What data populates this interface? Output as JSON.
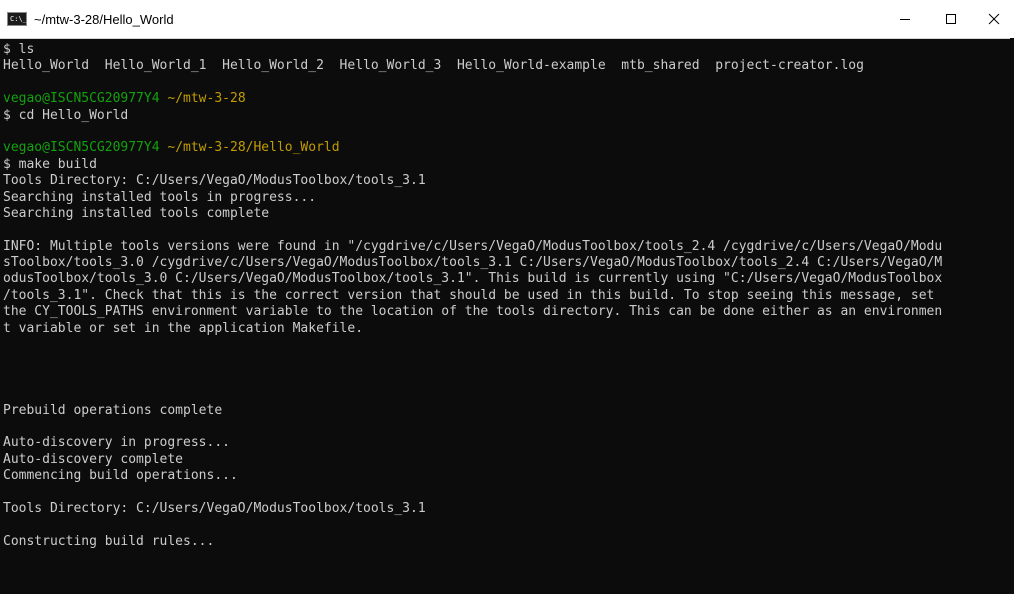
{
  "window": {
    "title": "~/mtw-3-28/Hello_World",
    "icon_text": "C:\\_",
    "icons": [
      "console-app-icon",
      "minimize-icon",
      "maximize-icon",
      "close-icon"
    ]
  },
  "colors": {
    "background": "#0c0c0c",
    "text": "#cccccc",
    "prompt_user": "#13a10e",
    "prompt_path": "#c19c00"
  },
  "terminal": {
    "lines": [
      "$ ls",
      "Hello_World  Hello_World_1  Hello_World_2  Hello_World_3  Hello_World-example  mtb_shared  project-creator.log",
      "",
      {
        "user": "vegao@ISCN5CG20977Y4",
        "path": "~/mtw-3-28"
      },
      "$ cd Hello_World",
      "",
      {
        "user": "vegao@ISCN5CG20977Y4",
        "path": "~/mtw-3-28/Hello_World"
      },
      "$ make build",
      "Tools Directory: C:/Users/VegaO/ModusToolbox/tools_3.1",
      "Searching installed tools in progress...",
      "Searching installed tools complete",
      "",
      "INFO: Multiple tools versions were found in \"/cygdrive/c/Users/VegaO/ModusToolbox/tools_2.4 /cygdrive/c/Users/VegaO/Modu",
      "sToolbox/tools_3.0 /cygdrive/c/Users/VegaO/ModusToolbox/tools_3.1 C:/Users/VegaO/ModusToolbox/tools_2.4 C:/Users/VegaO/M",
      "odusToolbox/tools_3.0 C:/Users/VegaO/ModusToolbox/tools_3.1\". This build is currently using \"C:/Users/VegaO/ModusToolbox",
      "/tools_3.1\". Check that this is the correct version that should be used in this build. To stop seeing this message, set",
      "the CY_TOOLS_PATHS environment variable to the location of the tools directory. This can be done either as an environmen",
      "t variable or set in the application Makefile.",
      "",
      "",
      "",
      "",
      "Prebuild operations complete",
      "",
      "Auto-discovery in progress...",
      "Auto-discovery complete",
      "Commencing build operations...",
      "",
      "Tools Directory: C:/Users/VegaO/ModusToolbox/tools_3.1",
      "",
      "Constructing build rules..."
    ]
  }
}
